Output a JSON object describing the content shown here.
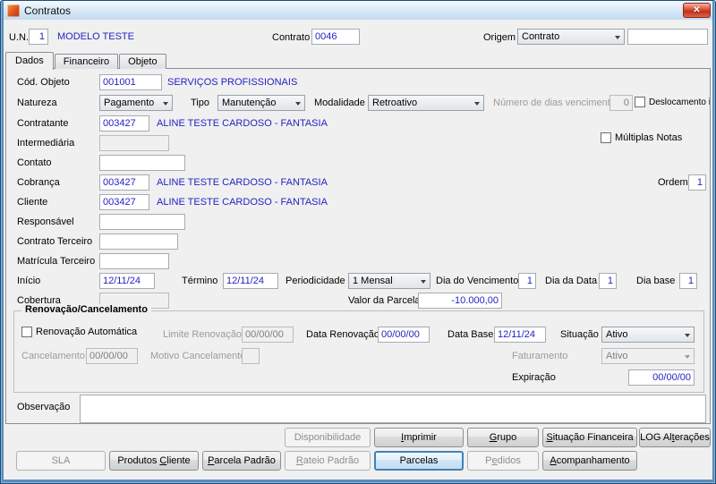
{
  "window": {
    "title": "Contratos",
    "close_glyph": "✕"
  },
  "header": {
    "un_label": "U.N.",
    "un_value": "1",
    "un_name": "MODELO TESTE",
    "contrato_label": "Contrato",
    "contrato_value": "0046",
    "origem_label": "Origem",
    "origem_value": "Contrato",
    "origem_extra": ""
  },
  "tabs": [
    {
      "label": "Dados"
    },
    {
      "label": "Financeiro"
    },
    {
      "label": "Objeto"
    }
  ],
  "form": {
    "cod_objeto": {
      "label": "Cód. Objeto",
      "value": "001001",
      "desc": "SERVIÇOS PROFISSIONAIS"
    },
    "natureza": {
      "label": "Natureza",
      "value": "Pagamento"
    },
    "tipo": {
      "label": "Tipo",
      "value": "Manutenção"
    },
    "modalidade": {
      "label": "Modalidade",
      "value": "Retroativo"
    },
    "dias_vencimento": {
      "label": "Número de dias vencimento",
      "value": "0"
    },
    "deslocamento": {
      "label": "Deslocamento incluso",
      "checked": false
    },
    "contratante": {
      "label": "Contratante",
      "value": "003427",
      "desc": "ALINE TESTE CARDOSO - FANTASIA"
    },
    "multiplas_notas": {
      "label": "Múltiplas Notas",
      "checked": false
    },
    "intermediaria": {
      "label": "Intermediária",
      "value": ""
    },
    "contato": {
      "label": "Contato",
      "value": ""
    },
    "cobranca": {
      "label": "Cobrança",
      "value": "003427",
      "desc": "ALINE TESTE CARDOSO - FANTASIA"
    },
    "ordem": {
      "label": "Ordem",
      "value": "1"
    },
    "cliente": {
      "label": "Cliente",
      "value": "003427",
      "desc": "ALINE TESTE CARDOSO - FANTASIA"
    },
    "responsavel": {
      "label": "Responsável",
      "value": ""
    },
    "contrato_terceiro": {
      "label": "Contrato Terceiro",
      "value": ""
    },
    "matricula_terceiro": {
      "label": "Matrícula Terceiro",
      "value": ""
    },
    "inicio": {
      "label": "Início",
      "value": "12/11/24"
    },
    "termino": {
      "label": "Término",
      "value": "12/11/24"
    },
    "periodicidade": {
      "label": "Periodicidade",
      "value": "1 Mensal"
    },
    "dia_vencimento": {
      "label": "Dia do Vencimento",
      "value": "1"
    },
    "dia_data": {
      "label": "Dia da Data",
      "value": "1"
    },
    "dia_base": {
      "label": "Dia base",
      "value": "1"
    },
    "cobertura": {
      "label": "Cobertura",
      "value": ""
    },
    "valor_parcela": {
      "label": "Valor da Parcela",
      "value": "-10.000,00"
    },
    "observacao": {
      "label": "Observação",
      "value": ""
    }
  },
  "renovacao": {
    "group_title": "Renovação/Cancelamento",
    "renovacao_automatica": {
      "label": "Renovação Automática",
      "checked": false
    },
    "limite_renovacao": {
      "label": "Limite Renovação",
      "value": "00/00/00"
    },
    "data_renovacao": {
      "label": "Data Renovação",
      "value": "00/00/00"
    },
    "data_base": {
      "label": "Data Base",
      "value": "12/11/24"
    },
    "situacao": {
      "label": "Situação",
      "value": "Ativo"
    },
    "cancelamento": {
      "label": "Cancelamento",
      "value": "00/00/00"
    },
    "motivo_cancelamento": {
      "label": "Motivo Cancelamento",
      "value": ""
    },
    "faturamento": {
      "label": "Faturamento",
      "value": "Ativo"
    },
    "expiracao": {
      "label": "Expiração",
      "value": "00/00/00"
    }
  },
  "buttons": {
    "disponibilidade": "Disponibilidade",
    "imprimir": "&Imprimir",
    "grupo": "&Grupo",
    "situacao_financeira": "&Situação Financeira",
    "log_alteracoes": "LOG Al&terações",
    "sla": "SLA",
    "produtos_cliente": "Produtos &Cliente",
    "parcela_padrao": "&Parcela Padrão",
    "rateio_padrao": "&Rateio Padrão",
    "parcelas": "Parcelas",
    "pedidos": "P&edidos",
    "acompanhamento": "&Acompanhamento"
  }
}
